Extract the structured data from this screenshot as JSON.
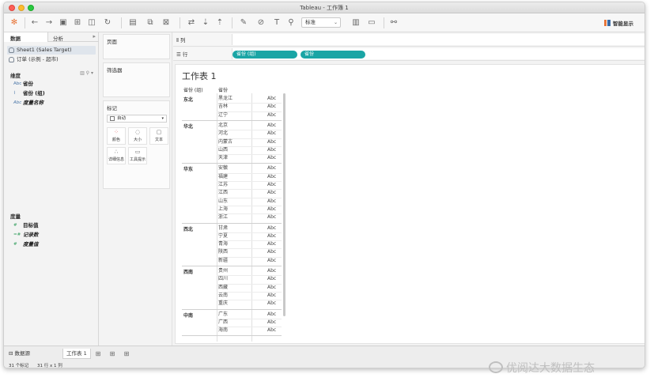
{
  "window": {
    "title": "Tableau - 工作簿 1"
  },
  "toolbar": {
    "fit_value": "标准",
    "show_me_label": "智能显示"
  },
  "left_pane": {
    "tabs": [
      "数据",
      "分析"
    ],
    "datasources": [
      {
        "label": "Sheet1 (Sales Target)",
        "selected": true
      },
      {
        "label": "订单 (示例 - 超市)",
        "selected": false
      }
    ],
    "dimensions_header": "维度",
    "dimensions": [
      {
        "label": "省份",
        "icon": "Abc"
      },
      {
        "label": "省份 (组)",
        "icon": "paperclip-icon"
      },
      {
        "label": "度量名称",
        "icon": "Abc"
      }
    ],
    "measures_header": "度量",
    "measures": [
      {
        "label": "目标值",
        "icon": "#"
      },
      {
        "label": "记录数",
        "icon": "=#"
      },
      {
        "label": "度量值",
        "icon": "#"
      }
    ]
  },
  "cards": {
    "pages": "页面",
    "filters": "筛选器",
    "marks": "标记",
    "mark_type": "自动",
    "buttons": [
      "颜色",
      "大小",
      "文本",
      "详细信息",
      "工具提示"
    ]
  },
  "shelves": {
    "columns_label": "列",
    "rows_label": "行",
    "row_pills": [
      "省份 (组)",
      "省份"
    ]
  },
  "view": {
    "sheet_title": "工作表 1",
    "headers": [
      "省份 (组)",
      "省份"
    ],
    "cell_text": "Abc",
    "groups": [
      {
        "region": "东北",
        "provinces": [
          "黑龙江",
          "吉林",
          "辽宁"
        ]
      },
      {
        "region": "华北",
        "provinces": [
          "北京",
          "河北",
          "内蒙古",
          "山西",
          "天津"
        ]
      },
      {
        "region": "华东",
        "provinces": [
          "安徽",
          "福建",
          "江苏",
          "江西",
          "山东",
          "上海",
          "浙江"
        ]
      },
      {
        "region": "西北",
        "provinces": [
          "甘肃",
          "宁夏",
          "青海",
          "陕西",
          "新疆"
        ]
      },
      {
        "region": "西南",
        "provinces": [
          "贵州",
          "四川",
          "西藏",
          "云南",
          "重庆"
        ]
      },
      {
        "region": "中南",
        "provinces": [
          "广东",
          "广西",
          "海南"
        ]
      }
    ]
  },
  "statusbar": {
    "datasource_tab": "数据源",
    "sheet_tab": "工作表 1",
    "marks_count": "31 个标记",
    "rows_cols": "31 行 x 1 列"
  },
  "watermark": "优阅达大数据生态",
  "colors": {
    "pill": "#1aa5a5",
    "accent": "#e8763a"
  }
}
